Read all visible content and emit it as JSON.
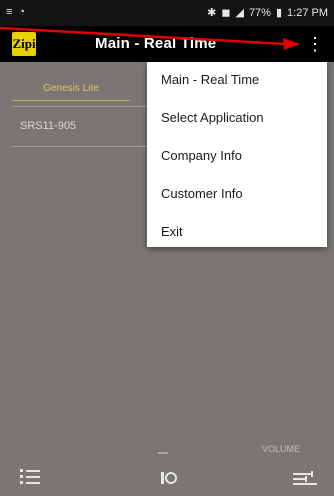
{
  "status_bar": {
    "left_icons": [
      "notification-icon",
      "wifi-icon"
    ],
    "right_icons": [
      "bluetooth-icon",
      "mute-icon",
      "signal-icon"
    ],
    "battery": "77%",
    "time": "1:27 PM"
  },
  "app_bar": {
    "logo_text": "Zipi",
    "title": "Main - Real Time",
    "overflow_label": "⋮"
  },
  "list": {
    "device_label": "Genesis Lite",
    "serial": "SRS11-905"
  },
  "menu": {
    "items": [
      {
        "label": "Main - Real Time"
      },
      {
        "label": "Select Application"
      },
      {
        "label": "Company Info"
      },
      {
        "label": "Customer Info"
      },
      {
        "label": "Exit"
      }
    ]
  },
  "bottom": {
    "left_icon": "list-icon",
    "mid_icon": "record-icon",
    "right_icon": "settings-icon",
    "label": "VOLUME"
  },
  "colors": {
    "background": "#7a7674",
    "app_bar": "#000000",
    "logo": "#e8d100",
    "annotation_arrow": "#e00000"
  }
}
